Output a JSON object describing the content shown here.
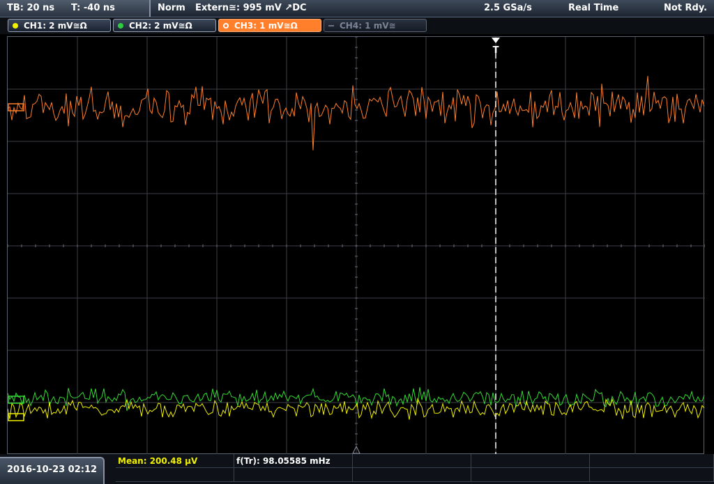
{
  "topbar": {
    "timebase": "TB: 20 ns",
    "trigger_offset": "T: -40 ns",
    "mode": "Norm",
    "trigger_source": "Extern≅: 995 mV ↗DC",
    "sample_rate": "2.5 GSa/s",
    "acq_mode": "Real Time",
    "status": "Not Rdy."
  },
  "channels": [
    {
      "label": "CH1: 2 mV≅Ω",
      "color": "#f2f200"
    },
    {
      "label": "CH2: 2 mV≅Ω",
      "color": "#2ecc40"
    },
    {
      "label": "CH3: 1 mV≅Ω",
      "color": "#ff7f2a"
    },
    {
      "label": "CH4: 1 mV≅",
      "color": "#6a7384"
    }
  ],
  "colors": {
    "ch1": "#f2f200",
    "ch2": "#33dd33",
    "ch3": "#ff7f2a",
    "grid": "#3c4048",
    "trigger": "#ffffff"
  },
  "icons": {
    "trigger_marker": "trigger-t-icon",
    "ground_marker": "ground-triangle-icon"
  },
  "trigger_marker": "T",
  "bottombar": {
    "datetime": "2016-10-23 02:12",
    "mean": "Mean: 200.48 µV",
    "freq": "f(Tr): 98.05585 mHz"
  }
}
